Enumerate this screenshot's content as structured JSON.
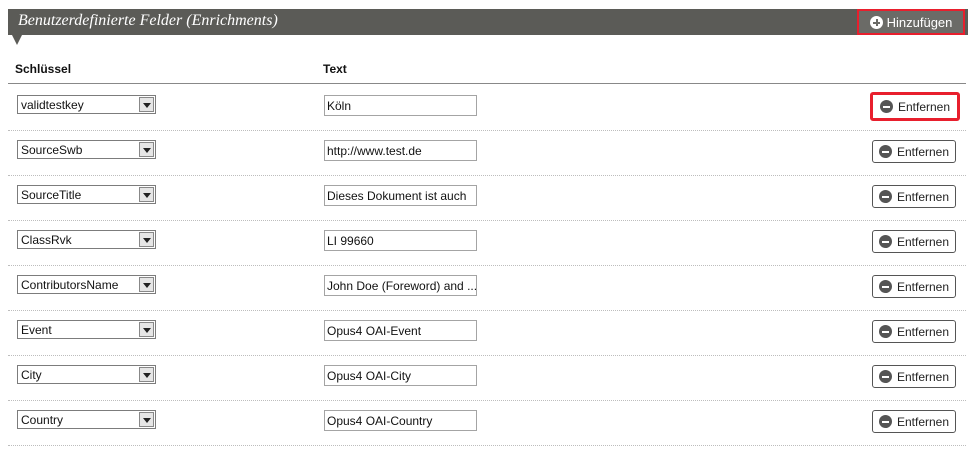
{
  "section": {
    "title": "Benutzerdefinierte Felder (Enrichments)",
    "add_label": "Hinzufügen"
  },
  "columns": {
    "key": "Schlüssel",
    "text": "Text"
  },
  "remove_label": "Entfernen",
  "rows": [
    {
      "key": "validtestkey",
      "text": "Köln"
    },
    {
      "key": "SourceSwb",
      "text": "http://www.test.de"
    },
    {
      "key": "SourceTitle",
      "text": "Dieses Dokument ist auch"
    },
    {
      "key": "ClassRvk",
      "text": "LI 99660"
    },
    {
      "key": "ContributorsName",
      "text": "John Doe (Foreword) and ..."
    },
    {
      "key": "Event",
      "text": "Opus4 OAI-Event"
    },
    {
      "key": "City",
      "text": "Opus4 OAI-City"
    },
    {
      "key": "Country",
      "text": "Opus4 OAI-Country"
    }
  ],
  "icons": {
    "add": "plus-circle-icon",
    "remove": "minus-circle-icon",
    "dropdown": "chevron-down-icon"
  },
  "colors": {
    "header_bg": "#5b5b57",
    "highlight": "#e81f2d"
  }
}
